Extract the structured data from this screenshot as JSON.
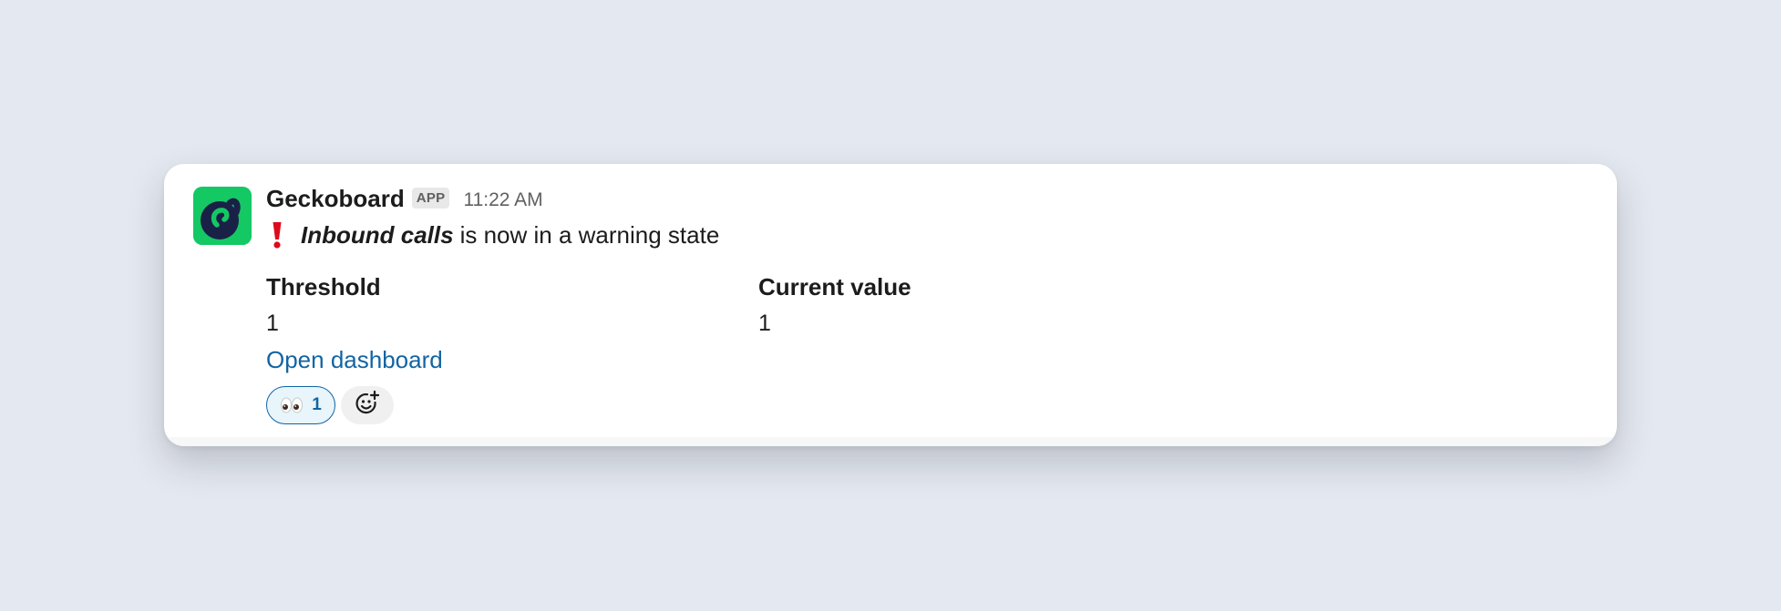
{
  "message": {
    "sender": "Geckoboard",
    "badge": "APP",
    "timestamp": "11:22 AM",
    "metric_name": "Inbound calls",
    "status_text": "is now in a warning state"
  },
  "fields": [
    {
      "label": "Threshold",
      "value": "1"
    },
    {
      "label": "Current value",
      "value": "1"
    }
  ],
  "link": {
    "label": "Open dashboard"
  },
  "reactions": [
    {
      "emoji": "eyes-icon",
      "count": "1"
    }
  ],
  "icons": {
    "avatar": "geckoboard-logo-icon",
    "status": "exclamation-icon",
    "add_reaction": "add-reaction-icon"
  },
  "colors": {
    "page_background": "#e4e8f0",
    "card_background": "#ffffff",
    "link": "#1264a3",
    "logo_green": "#14c864",
    "logo_navy": "#1a2146",
    "warning_red": "#dd0b1c",
    "reaction_border": "#1264a3",
    "reaction_background": "#e8f5fa"
  }
}
